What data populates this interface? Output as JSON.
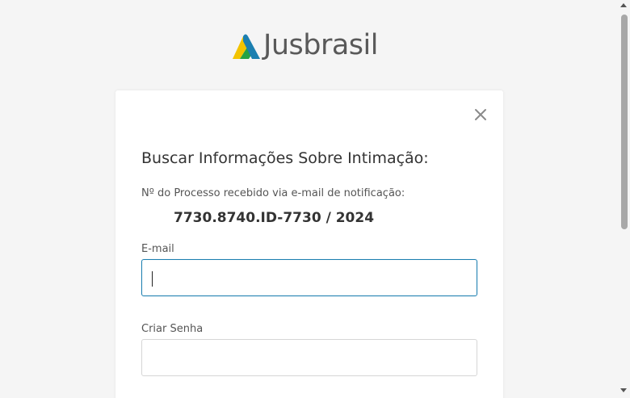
{
  "brand": {
    "name": "Jusbrasil",
    "colors": {
      "yellow": "#f2c300",
      "green": "#25a244",
      "blue": "#1c7fb0",
      "text": "#595959"
    }
  },
  "modal": {
    "close_icon": "close-icon",
    "title": "Buscar Informações Sobre Intimação:",
    "process_label": "Nº do Processo recebido via e-mail de notificação:",
    "process_number": "7730.8740.ID-7730 / 2024",
    "email": {
      "label": "E-mail",
      "value": "",
      "placeholder": ""
    },
    "password": {
      "label": "Criar Senha",
      "value": "",
      "placeholder": ""
    }
  },
  "colors": {
    "background": "#f5f5f5",
    "card": "#ffffff",
    "focus_border": "#1c7fb0",
    "input_border": "#d6d6d6"
  }
}
